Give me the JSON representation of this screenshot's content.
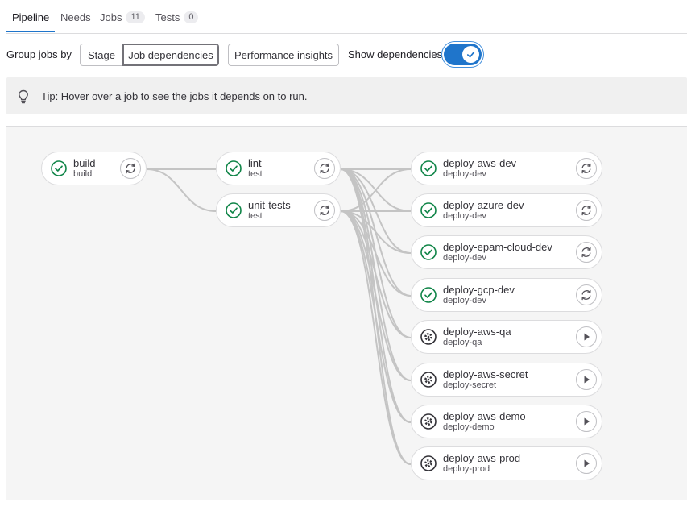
{
  "tabs": [
    {
      "label": "Pipeline"
    },
    {
      "label": "Needs"
    },
    {
      "label": "Jobs",
      "count": "11"
    },
    {
      "label": "Tests",
      "count": "0"
    }
  ],
  "toolbar": {
    "group_label": "Group jobs by",
    "stage_label": "Stage",
    "job_dependencies_label": "Job dependencies",
    "selected_grouping": "Job dependencies",
    "performance_label": "Performance insights",
    "show_dependencies_label": "Show dependencies",
    "show_dependencies_on": true
  },
  "tip": {
    "text": "Tip: Hover over a job to see the jobs it depends on to run.",
    "icon": "bulb-icon"
  },
  "colors": {
    "accent": "#1f75cb",
    "success": "#108548",
    "manual": "#333238",
    "link": "#c4c4c4"
  },
  "jobs": [
    {
      "name": "build",
      "stage": "build",
      "status": "success",
      "action": "retry"
    },
    {
      "name": "lint",
      "stage": "test",
      "status": "success",
      "action": "retry"
    },
    {
      "name": "unit-tests",
      "stage": "test",
      "status": "success",
      "action": "retry"
    },
    {
      "name": "deploy-aws-dev",
      "stage": "deploy-dev",
      "status": "success",
      "action": "retry"
    },
    {
      "name": "deploy-azure-dev",
      "stage": "deploy-dev",
      "status": "success",
      "action": "retry"
    },
    {
      "name": "deploy-epam-cloud-dev",
      "stage": "deploy-dev",
      "status": "success",
      "action": "retry"
    },
    {
      "name": "deploy-gcp-dev",
      "stage": "deploy-dev",
      "status": "success",
      "action": "retry"
    },
    {
      "name": "deploy-aws-qa",
      "stage": "deploy-qa",
      "status": "manual",
      "action": "play"
    },
    {
      "name": "deploy-aws-secret",
      "stage": "deploy-secret",
      "status": "manual",
      "action": "play"
    },
    {
      "name": "deploy-aws-demo",
      "stage": "deploy-demo",
      "status": "manual",
      "action": "play"
    },
    {
      "name": "deploy-aws-prod",
      "stage": "deploy-prod",
      "status": "manual",
      "action": "play"
    }
  ],
  "dependencies": {
    "lint": [
      "build"
    ],
    "unit-tests": [
      "build"
    ],
    "deploy-aws-dev": [
      "lint",
      "unit-tests"
    ],
    "deploy-azure-dev": [
      "lint",
      "unit-tests"
    ],
    "deploy-epam-cloud-dev": [
      "lint",
      "unit-tests"
    ],
    "deploy-gcp-dev": [
      "lint",
      "unit-tests"
    ],
    "deploy-aws-qa": [
      "lint",
      "unit-tests"
    ],
    "deploy-aws-secret": [
      "lint",
      "unit-tests"
    ],
    "deploy-aws-demo": [
      "lint",
      "unit-tests"
    ],
    "deploy-aws-prod": [
      "lint",
      "unit-tests"
    ]
  }
}
